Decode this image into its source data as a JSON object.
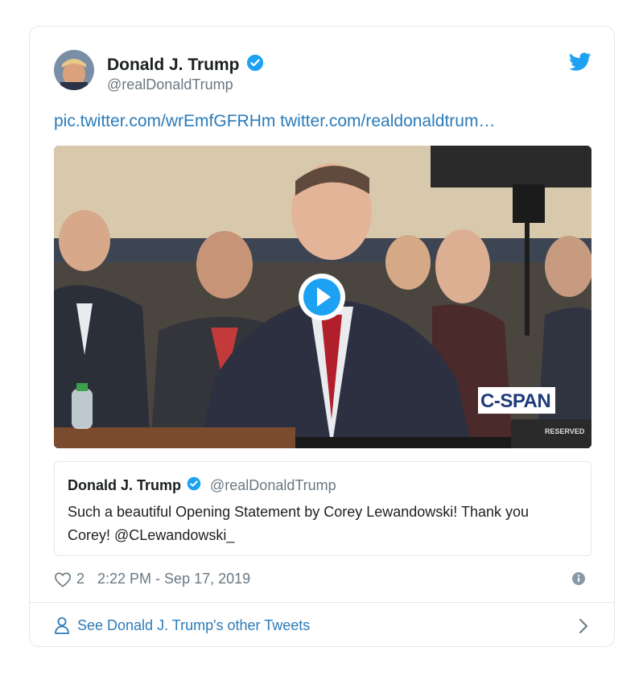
{
  "tweet": {
    "author_name": "Donald J. Trump",
    "author_handle": "@realDonaldTrump",
    "link_text": "pic.twitter.com/wrEmfGFRHm twitter.com/realdonaldtrum…",
    "likes": "2",
    "timestamp": "2:22 PM - Sep 17, 2019"
  },
  "media": {
    "network_label": "C-SPAN",
    "corner_label": "RESERVED"
  },
  "quoted_tweet": {
    "author_name": "Donald J. Trump",
    "author_handle": "@realDonaldTrump",
    "text": "Such a beautiful Opening Statement by Corey Lewandowski! Thank you Corey! @CLewandowski_"
  },
  "footer": {
    "label": "See Donald J. Trump's other Tweets"
  },
  "colors": {
    "accent": "#1da1f2",
    "link": "#2b7bb9",
    "muted": "#697882"
  },
  "icons": [
    "verified-icon",
    "twitter-bird-icon",
    "play-icon",
    "heart-icon",
    "info-icon",
    "person-icon",
    "chevron-right-icon"
  ]
}
